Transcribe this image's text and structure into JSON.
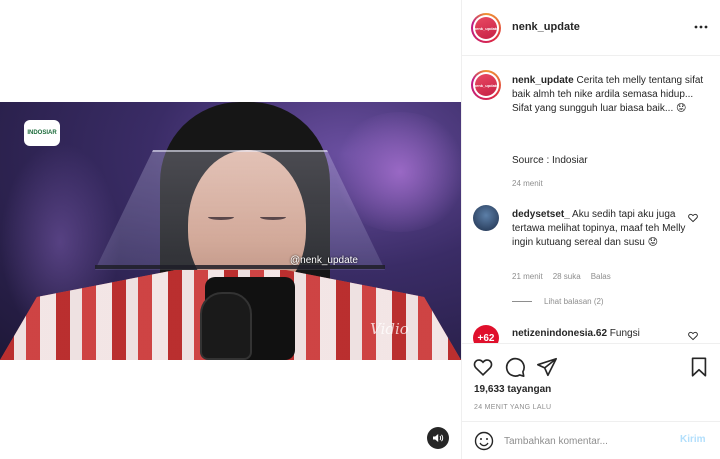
{
  "video": {
    "channel_logo_text": "INDOSIAR",
    "watermark": "@nenk_update",
    "overlay_word": "Vidio",
    "mute_icon": "speaker-icon"
  },
  "post": {
    "username": "nenk_update",
    "avatar_text": "nenk_update",
    "more_icon": "more-horizontal-icon",
    "caption": {
      "username": "nenk_update",
      "text": " Cerita teh melly tentang sifat baik almh teh nike ardila semasa hidup... Sifat yang sungguh luar biasa baik... 😟",
      "source": "Source : Indosiar",
      "time": "24 menit"
    },
    "comments": [
      {
        "username": "dedysetset_",
        "text": " Aku sedih tapi aku juga tertawa melihat topinya, maaf teh Melly ingin kutuang sereal dan susu 😟",
        "time": "21 menit",
        "likes": "28 suka",
        "reply_label": "Balas",
        "view_replies": "Lihat balasan (2)"
      },
      {
        "username": "netizenindonesia.62",
        "avatar_text": "+62",
        "text": " Fungsi"
      }
    ],
    "views": "19,633 tayangan",
    "posted_ago": "24 MENIT YANG LALU",
    "comment_placeholder": "Tambahkan komentar...",
    "send_label": "Kirim"
  },
  "colors": {
    "send_disabled": "#b2dffc",
    "secondary_text": "#8e8e8e",
    "primary_text": "#262626"
  }
}
